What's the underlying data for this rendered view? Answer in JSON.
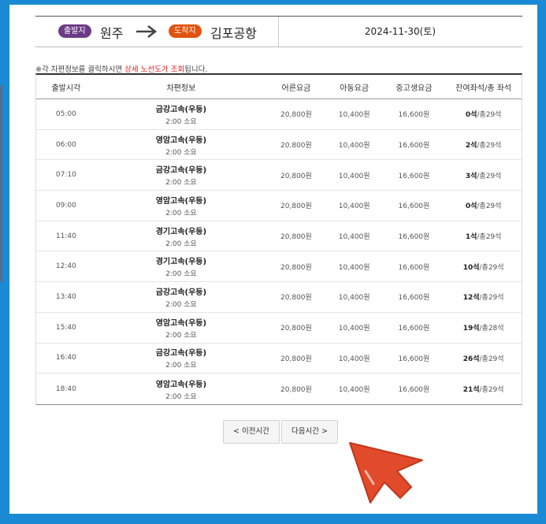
{
  "route": {
    "departure_badge": "출발지",
    "departure_city": "원주",
    "arrival_badge": "도착지",
    "arrival_city": "김포공항",
    "date": "2024-11-30(토)"
  },
  "notice": {
    "prefix": "※각 차편정보를 클릭하시면 ",
    "highlight": "상세 노선도가 조회",
    "suffix": "됩니다."
  },
  "table": {
    "headers": [
      "출발시각",
      "차편정보",
      "어른요금",
      "아동요금",
      "중고생요금",
      "잔여좌석/총 좌석"
    ],
    "rows": [
      {
        "time": "05:00",
        "company": "금강고속(우등)",
        "duration": "2:00 소요",
        "adult": "20,800원",
        "child": "10,400원",
        "teen": "16,600원",
        "seats_left": "0석",
        "seats_total": "/총29석"
      },
      {
        "time": "06:00",
        "company": "영암고속(우등)",
        "duration": "2:00 소요",
        "adult": "20,800원",
        "child": "10,400원",
        "teen": "16,600원",
        "seats_left": "2석",
        "seats_total": "/총29석"
      },
      {
        "time": "07:10",
        "company": "금강고속(우등)",
        "duration": "2:00 소요",
        "adult": "20,800원",
        "child": "10,400원",
        "teen": "16,600원",
        "seats_left": "3석",
        "seats_total": "/총29석"
      },
      {
        "time": "09:00",
        "company": "영암고속(우등)",
        "duration": "2:00 소요",
        "adult": "20,800원",
        "child": "10,400원",
        "teen": "16,600원",
        "seats_left": "0석",
        "seats_total": "/총29석"
      },
      {
        "time": "11:40",
        "company": "경기고속(우등)",
        "duration": "2:00 소요",
        "adult": "20,800원",
        "child": "10,400원",
        "teen": "16,600원",
        "seats_left": "1석",
        "seats_total": "/총29석"
      },
      {
        "time": "12:40",
        "company": "경기고속(우등)",
        "duration": "2:00 소요",
        "adult": "20,800원",
        "child": "10,400원",
        "teen": "16,600원",
        "seats_left": "10석",
        "seats_total": "/총29석"
      },
      {
        "time": "13:40",
        "company": "금강고속(우등)",
        "duration": "2:00 소요",
        "adult": "20,800원",
        "child": "10,400원",
        "teen": "16,600원",
        "seats_left": "12석",
        "seats_total": "/총29석"
      },
      {
        "time": "15:40",
        "company": "영암고속(우등)",
        "duration": "2:00 소요",
        "adult": "20,800원",
        "child": "10,400원",
        "teen": "16,600원",
        "seats_left": "19석",
        "seats_total": "/총28석"
      },
      {
        "time": "16:40",
        "company": "금강고속(우등)",
        "duration": "2:00 소요",
        "adult": "20,800원",
        "child": "10,400원",
        "teen": "16,600원",
        "seats_left": "26석",
        "seats_total": "/총29석"
      },
      {
        "time": "18:40",
        "company": "영암고속(우등)",
        "duration": "2:00 소요",
        "adult": "20,800원",
        "child": "10,400원",
        "teen": "16,600원",
        "seats_left": "21석",
        "seats_total": "/총29석"
      }
    ]
  },
  "pager": {
    "prev_label": "< 이전시간",
    "next_label": "다음시간 >"
  },
  "colors": {
    "background": "#1a8ad4",
    "departure_badge": "#6b3b86",
    "arrival_badge": "#e0540f",
    "highlight": "#e02020",
    "cursor": "#e24a2c"
  },
  "icons": {
    "route_arrow": "arrow-right-icon",
    "pointer": "cursor-arrow-icon"
  }
}
